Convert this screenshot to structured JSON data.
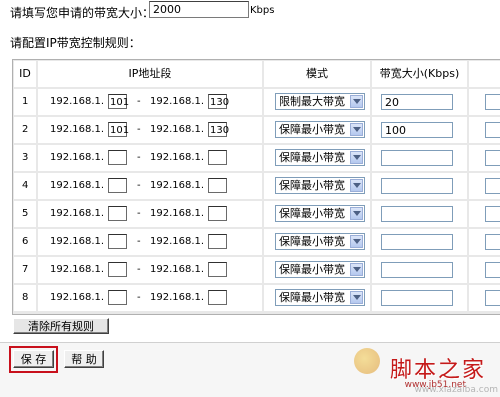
{
  "bandwidth": {
    "label": "请填写您申请的带宽大小：",
    "value": "2000",
    "unit": "Kbps"
  },
  "rules_title": "请配置IP带宽控制规则：",
  "table": {
    "headers": [
      "ID",
      "IP地址段",
      "模式",
      "带宽大小(Kbps)"
    ],
    "ip_prefix": "192.168.1.",
    "dash": "-",
    "rows": [
      {
        "id": "1",
        "start": "101",
        "end": "130",
        "mode": "限制最大带宽",
        "bw": "20"
      },
      {
        "id": "2",
        "start": "101",
        "end": "130",
        "mode": "保障最小带宽",
        "bw": "100"
      },
      {
        "id": "3",
        "start": "",
        "end": "",
        "mode": "保障最小带宽",
        "bw": ""
      },
      {
        "id": "4",
        "start": "",
        "end": "",
        "mode": "保障最小带宽",
        "bw": ""
      },
      {
        "id": "5",
        "start": "",
        "end": "",
        "mode": "保障最小带宽",
        "bw": ""
      },
      {
        "id": "6",
        "start": "",
        "end": "",
        "mode": "保障最小带宽",
        "bw": ""
      },
      {
        "id": "7",
        "start": "",
        "end": "",
        "mode": "保障最小带宽",
        "bw": ""
      },
      {
        "id": "8",
        "start": "",
        "end": "",
        "mode": "保障最小带宽",
        "bw": ""
      }
    ]
  },
  "buttons": {
    "clear": "清除所有规则",
    "save": "保 存",
    "help": "帮 助"
  },
  "watermark": {
    "title": "脚本之家",
    "url": "www.jb51.net",
    "bg_url": "www.xiazaiba.com"
  },
  "colors": {
    "highlight": "#c8101c",
    "select_border": "#7f9db9"
  }
}
